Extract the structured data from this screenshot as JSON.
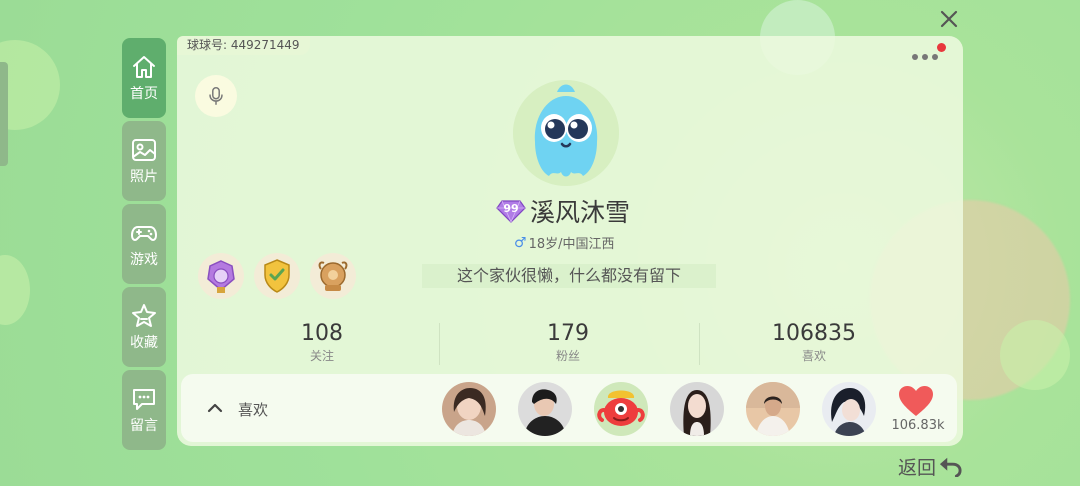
{
  "account": {
    "id_label": "球球号: 449271449"
  },
  "sidebar": {
    "items": [
      {
        "label": "首页",
        "icon": "home-icon",
        "active": true
      },
      {
        "label": "照片",
        "icon": "image-icon",
        "active": false
      },
      {
        "label": "游戏",
        "icon": "gamepad-icon",
        "active": false
      },
      {
        "label": "收藏",
        "icon": "star-icon",
        "active": false
      },
      {
        "label": "留言",
        "icon": "message-icon",
        "active": false
      }
    ]
  },
  "profile": {
    "vip_level": "99",
    "nickname": "溪风沐雪",
    "gender_symbol": "♂",
    "info": "18岁/中国江西",
    "bio": "这个家伙很懒，什么都没有留下"
  },
  "stats": [
    {
      "value": "108",
      "label": "关注"
    },
    {
      "value": "179",
      "label": "粉丝"
    },
    {
      "value": "106835",
      "label": "喜欢"
    }
  ],
  "likes": {
    "title": "喜欢",
    "count": "106.83k"
  },
  "actions": {
    "back_label": "返回"
  },
  "colors": {
    "accent_green": "#5fae6d",
    "nav_inactive": "#8fb88a",
    "heart_red": "#f05a5a",
    "notification_red": "#e8383d",
    "vip_purple": "#9a5bd6"
  }
}
